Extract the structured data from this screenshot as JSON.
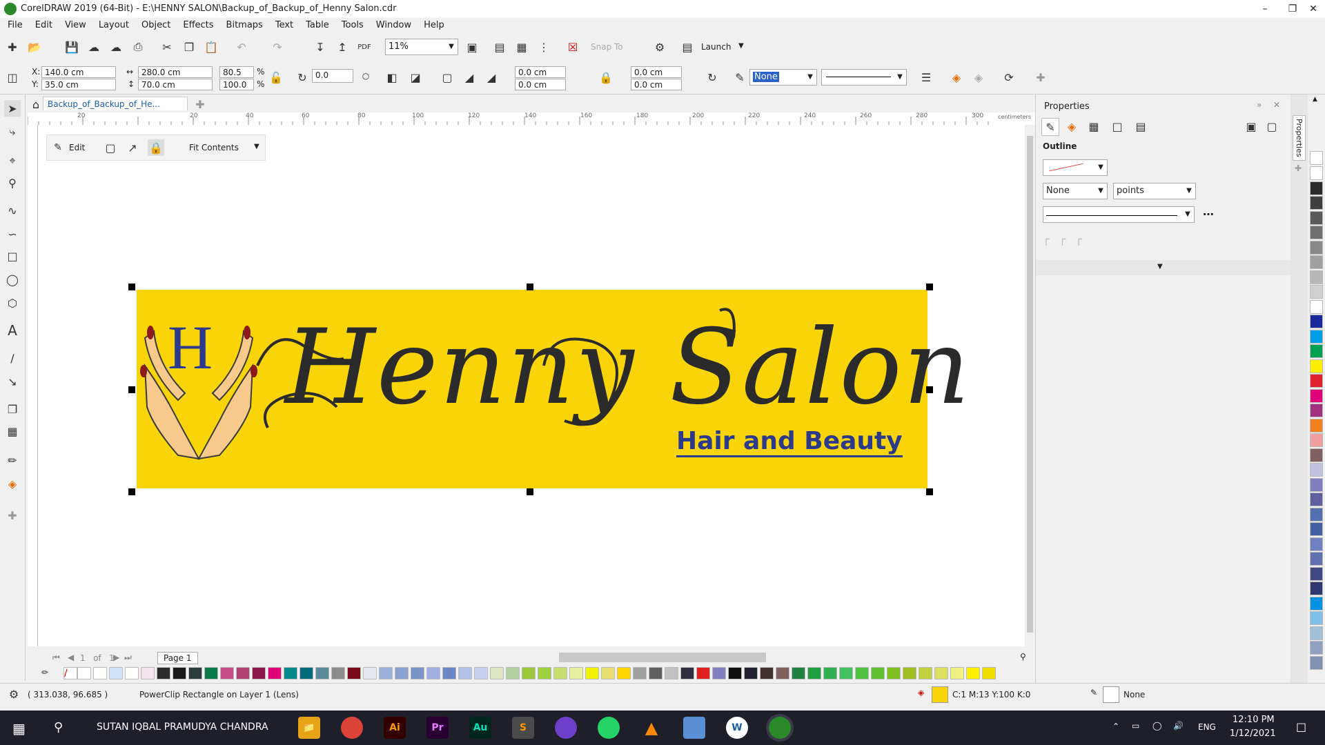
{
  "app": {
    "title": "CorelDRAW 2019 (64-Bit) - E:\\HENNY SALON\\Backup_of_Backup_of_Henny Salon.cdr"
  },
  "menu": [
    "File",
    "Edit",
    "View",
    "Layout",
    "Object",
    "Effects",
    "Bitmaps",
    "Text",
    "Table",
    "Tools",
    "Window",
    "Help"
  ],
  "toolbar": {
    "zoom": "11%",
    "snap_to": "Snap To",
    "launch": "Launch"
  },
  "propbar": {
    "x": "140.0 cm",
    "y": "35.0 cm",
    "w": "280.0 cm",
    "h": "70.0 cm",
    "sx": "80.5",
    "sy": "100.0",
    "pct": "%",
    "rot": "0.0",
    "c1": "0.0 cm",
    "c2": "0.0 cm",
    "c3": "0.0 cm",
    "c4": "0.0 cm",
    "outline": "None",
    "x_label": "X:",
    "y_label": "Y:"
  },
  "doc": {
    "tab": "Backup_of_Backup_of_He..."
  },
  "ruler": {
    "ticks": [
      "20",
      "20",
      "40",
      "60",
      "80",
      "100",
      "120",
      "140",
      "160",
      "180",
      "200",
      "220",
      "240",
      "260",
      "280",
      "300"
    ],
    "unit": "centimeters"
  },
  "powerclip": {
    "edit": "Edit",
    "fit": "Fit Contents"
  },
  "banner": {
    "title": "Henny Salon",
    "subtitle": "Hair and Beauty",
    "monogram": "H",
    "bg": "#f9d408"
  },
  "page": {
    "of": "1   of   1",
    "tab": "Page 1"
  },
  "status": {
    "coords": "( 313.038, 96.685 )",
    "object": "PowerClip Rectangle on Layer 1  (Lens)",
    "fill": "C:1 M:13 Y:100 K:0",
    "outline": "None"
  },
  "panel": {
    "title": "Properties",
    "section": "Outline",
    "width": "None",
    "units": "points",
    "dock_label": "Properties"
  },
  "taskbar": {
    "user": "SUTAN IQBAL PRAMUDYA CHANDRA",
    "lang": "ENG",
    "time": "12:10 PM",
    "date": "1/12/2021"
  },
  "colors": {
    "accent": "#1a5fa8",
    "banner": "#f9d408",
    "text_dark": "#2b2b2b",
    "navy": "#2b3a8a"
  }
}
